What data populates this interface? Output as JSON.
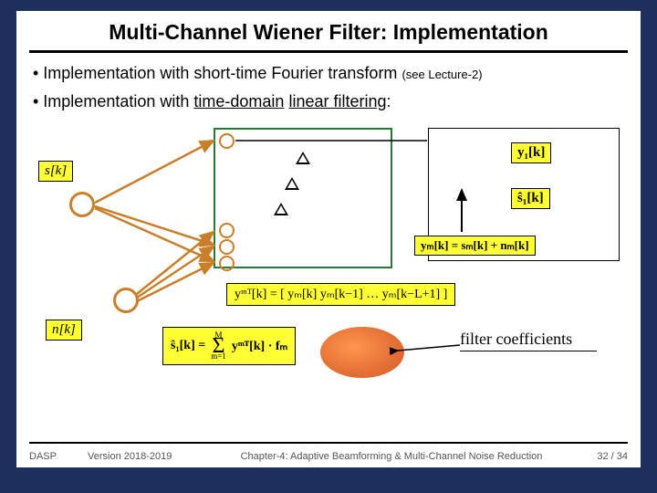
{
  "title": "Multi-Channel Wiener Filter: Implementation",
  "bullets": {
    "b1_main": "• Implementation with short-time Fourier transform ",
    "b1_note": "(see Lecture-2)",
    "b2_prefix": "• Implementation with ",
    "b2_u1": "time-domain",
    "b2_mid": " ",
    "b2_u2": "linear filtering",
    "b2_suffix": ":"
  },
  "labels": {
    "s_k": "s[k]",
    "n_k": "n[k]",
    "y1_k": "y₁[k]",
    "s1hat_k": "ŝ₁[k]",
    "ym_eq": "yₘ[k] = sₘ[k] + nₘ[k]",
    "vec_def": "yᵐᵀ[k] = [ yₘ[k]  yₘ[k−1]  …  yₘ[k−L+1] ]",
    "sum_lhs": "ŝ₁[k] =",
    "sum_sym": "Σ",
    "sum_upper": "M",
    "sum_lower": "m=1",
    "sum_rhs": "yᵐᵀ[k] · fₘ",
    "filter_label": "filter coefficients"
  },
  "footer": {
    "f1": "DASP",
    "f2": "Version 2018-2019",
    "f3": "Chapter-4: Adaptive Beamforming & Multi-Channel Noise Reduction",
    "f4": "32 / 34"
  }
}
